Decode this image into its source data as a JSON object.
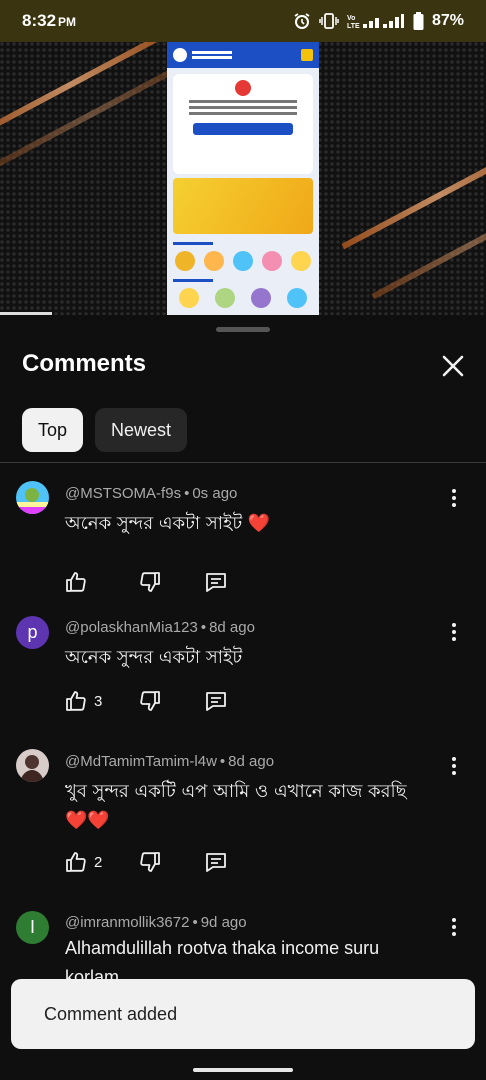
{
  "status_bar": {
    "time": "8:32",
    "ampm": "PM",
    "battery": "87%",
    "icons": [
      "alarm-icon",
      "vibrate-icon",
      "volte-icon",
      "lte-signal-icon",
      "battery-icon"
    ]
  },
  "video": {
    "thumbnail_icon": "app-screen-recording"
  },
  "sheet": {
    "title": "Comments",
    "close_icon": "close-icon",
    "tabs": [
      {
        "label": "Top",
        "active": true
      },
      {
        "label": "Newest",
        "active": false
      }
    ]
  },
  "comments": [
    {
      "author": "@MSTSOMA-f9s",
      "time": "0s ago",
      "text": "অনেক সুন্দর একটা সাইট",
      "emoji": "❤️",
      "likes": "",
      "avatar_color": "#4fc3f7",
      "avatar_letter": ""
    },
    {
      "author": "@polaskhanMia123",
      "time": "8d ago",
      "text": "অনেক সুন্দর একটা সাইট",
      "emoji": "",
      "likes": "3",
      "avatar_color": "#5e35b1",
      "avatar_letter": "p"
    },
    {
      "author": "@MdTamimTamim-l4w",
      "time": "8d ago",
      "text": "খুব সুন্দর একটি এপ আমি ও এখানে কাজ করছি",
      "emoji": "❤️❤️",
      "likes": "2",
      "avatar_color": "#8d6e63",
      "avatar_letter": ""
    },
    {
      "author": "@imranmollik3672",
      "time": "9d ago",
      "text": "Alhamdulillah rootva thaka income suru korlam",
      "emoji": "",
      "likes": "",
      "avatar_color": "#2e7d32",
      "avatar_letter": "I"
    }
  ],
  "toast": {
    "message": "Comment added"
  }
}
